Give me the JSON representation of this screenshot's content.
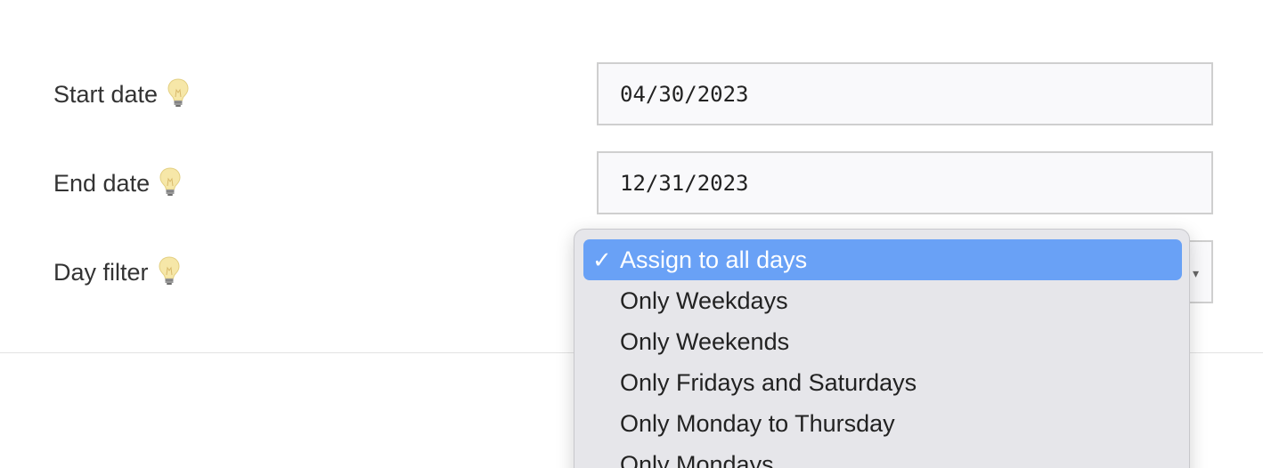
{
  "form": {
    "start_date": {
      "label": "Start date",
      "value": "04/30/2023",
      "hint_icon": "lightbulb-icon"
    },
    "end_date": {
      "label": "End date",
      "value": "12/31/2023",
      "hint_icon": "lightbulb-icon"
    },
    "day_filter": {
      "label": "Day filter",
      "hint_icon": "lightbulb-icon",
      "selected_value": "Assign to all days",
      "options": [
        "Assign to all days",
        "Only Weekdays",
        "Only Weekends",
        "Only Fridays and Saturdays",
        "Only Monday to Thursday",
        "Only Mondays"
      ]
    }
  },
  "colors": {
    "selected_option_bg": "#69a1f6",
    "dropdown_bg": "#e6e6ea",
    "input_bg": "#f9f9fb",
    "hint_icon": "#f6e7a8"
  }
}
